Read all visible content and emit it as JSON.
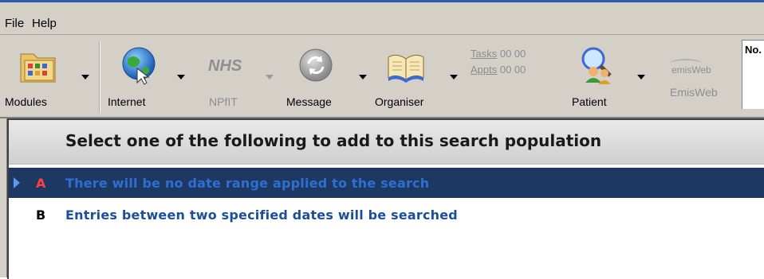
{
  "menu": {
    "file": "File",
    "help": "Help"
  },
  "toolbar": {
    "modules": "Modules",
    "internet": "Internet",
    "nhs_text": "NHS",
    "npfit": "NPfIT",
    "message": "Message",
    "organiser": "Organiser",
    "tasks_link": "Tasks",
    "tasks_count": "00 00",
    "appts_link": "Appts",
    "appts_count": "00 00",
    "patient": "Patient",
    "emis_logo": "emisWeb",
    "emisweb": "EmisWeb",
    "no_label": "No."
  },
  "panel": {
    "heading": "Select one of the following to add to this search population",
    "options": [
      {
        "key": "A",
        "text": "There will be no date range applied to the search",
        "selected": true
      },
      {
        "key": "B",
        "text": "Entries between two specified dates will be searched",
        "selected": false
      }
    ]
  },
  "colors": {
    "selected_row_bg": "#1c3863",
    "selected_key": "#ff4040",
    "selected_text": "#2e6fd0",
    "option_text": "#1b4f9a"
  }
}
